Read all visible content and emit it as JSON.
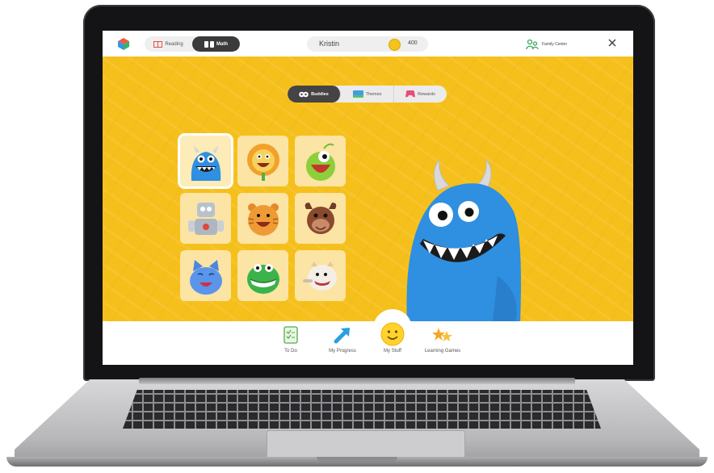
{
  "topbar": {
    "subjects": [
      {
        "label": "Reading",
        "icon": "book-icon",
        "active": false
      },
      {
        "label": "Math",
        "icon": "math-blocks-icon",
        "active": true
      }
    ],
    "student_name": "Kristin",
    "coins": "400",
    "family_center_label": "Family Center"
  },
  "tabs": [
    {
      "label": "Buddies",
      "icon": "buddies-icon",
      "active": true
    },
    {
      "label": "Themes",
      "icon": "themes-icon",
      "active": false
    },
    {
      "label": "Rewards",
      "icon": "rewards-icon",
      "active": false
    }
  ],
  "buddies": [
    {
      "name": "blue-horned-monster-buddy",
      "selected": true
    },
    {
      "name": "yellow-lion-buddy",
      "selected": false
    },
    {
      "name": "green-one-eyed-buddy",
      "selected": false
    },
    {
      "name": "robot-buddy",
      "selected": false
    },
    {
      "name": "orange-tiger-buddy",
      "selected": false
    },
    {
      "name": "brown-moose-buddy",
      "selected": false
    },
    {
      "name": "blue-cat-buddy",
      "selected": false
    },
    {
      "name": "green-dinosaur-buddy",
      "selected": false
    },
    {
      "name": "white-yeti-buddy",
      "selected": false
    }
  ],
  "bottom_nav": [
    {
      "label": "To Do",
      "icon": "checklist-icon"
    },
    {
      "label": "My Progress",
      "icon": "arrow-up-right-icon"
    },
    {
      "label": "My Stuff",
      "icon": "smiley-icon",
      "active": true
    },
    {
      "label": "Learning Games",
      "icon": "game-stars-icon"
    }
  ],
  "colors": {
    "stage_background": "#f6c01c",
    "buddy_blue": "#2f8fe0",
    "active_pill": "#3b3b3b"
  }
}
